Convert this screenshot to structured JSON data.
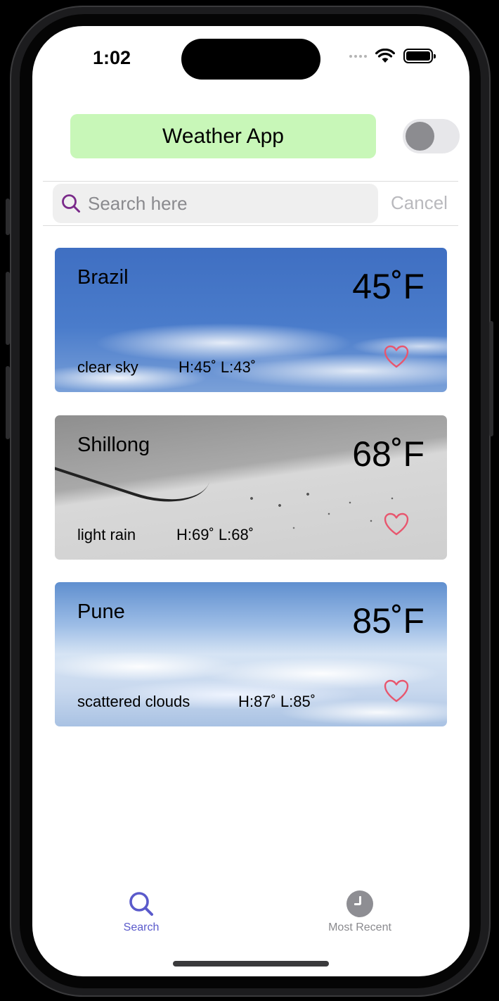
{
  "status_bar": {
    "time": "1:02"
  },
  "header": {
    "title": "Weather App",
    "toggle_on": false
  },
  "search": {
    "placeholder": "Search here",
    "value": "",
    "cancel_label": "Cancel"
  },
  "cards": [
    {
      "city": "Brazil",
      "temp": "45˚F",
      "description": "clear sky",
      "high_low": "H:45˚ L:43˚",
      "favorite": false,
      "background": "clear-sky"
    },
    {
      "city": "Shillong",
      "temp": "68˚F",
      "description": "light rain",
      "high_low": "H:69˚ L:68˚",
      "favorite": false,
      "background": "light-rain"
    },
    {
      "city": "Pune",
      "temp": "85˚F",
      "description": "scattered clouds",
      "high_low": "H:87˚ L:85˚",
      "favorite": false,
      "background": "scattered-clouds"
    }
  ],
  "tabs": [
    {
      "label": "Search",
      "icon": "search-icon",
      "active": true
    },
    {
      "label": "Most Recent",
      "icon": "clock-icon",
      "active": false
    }
  ],
  "colors": {
    "title_background": "#c8f7b8",
    "heart": "#e8566e",
    "tab_active": "#5a5acb",
    "tab_inactive": "#8a8a8e",
    "search_icon": "#7a2a8a"
  }
}
